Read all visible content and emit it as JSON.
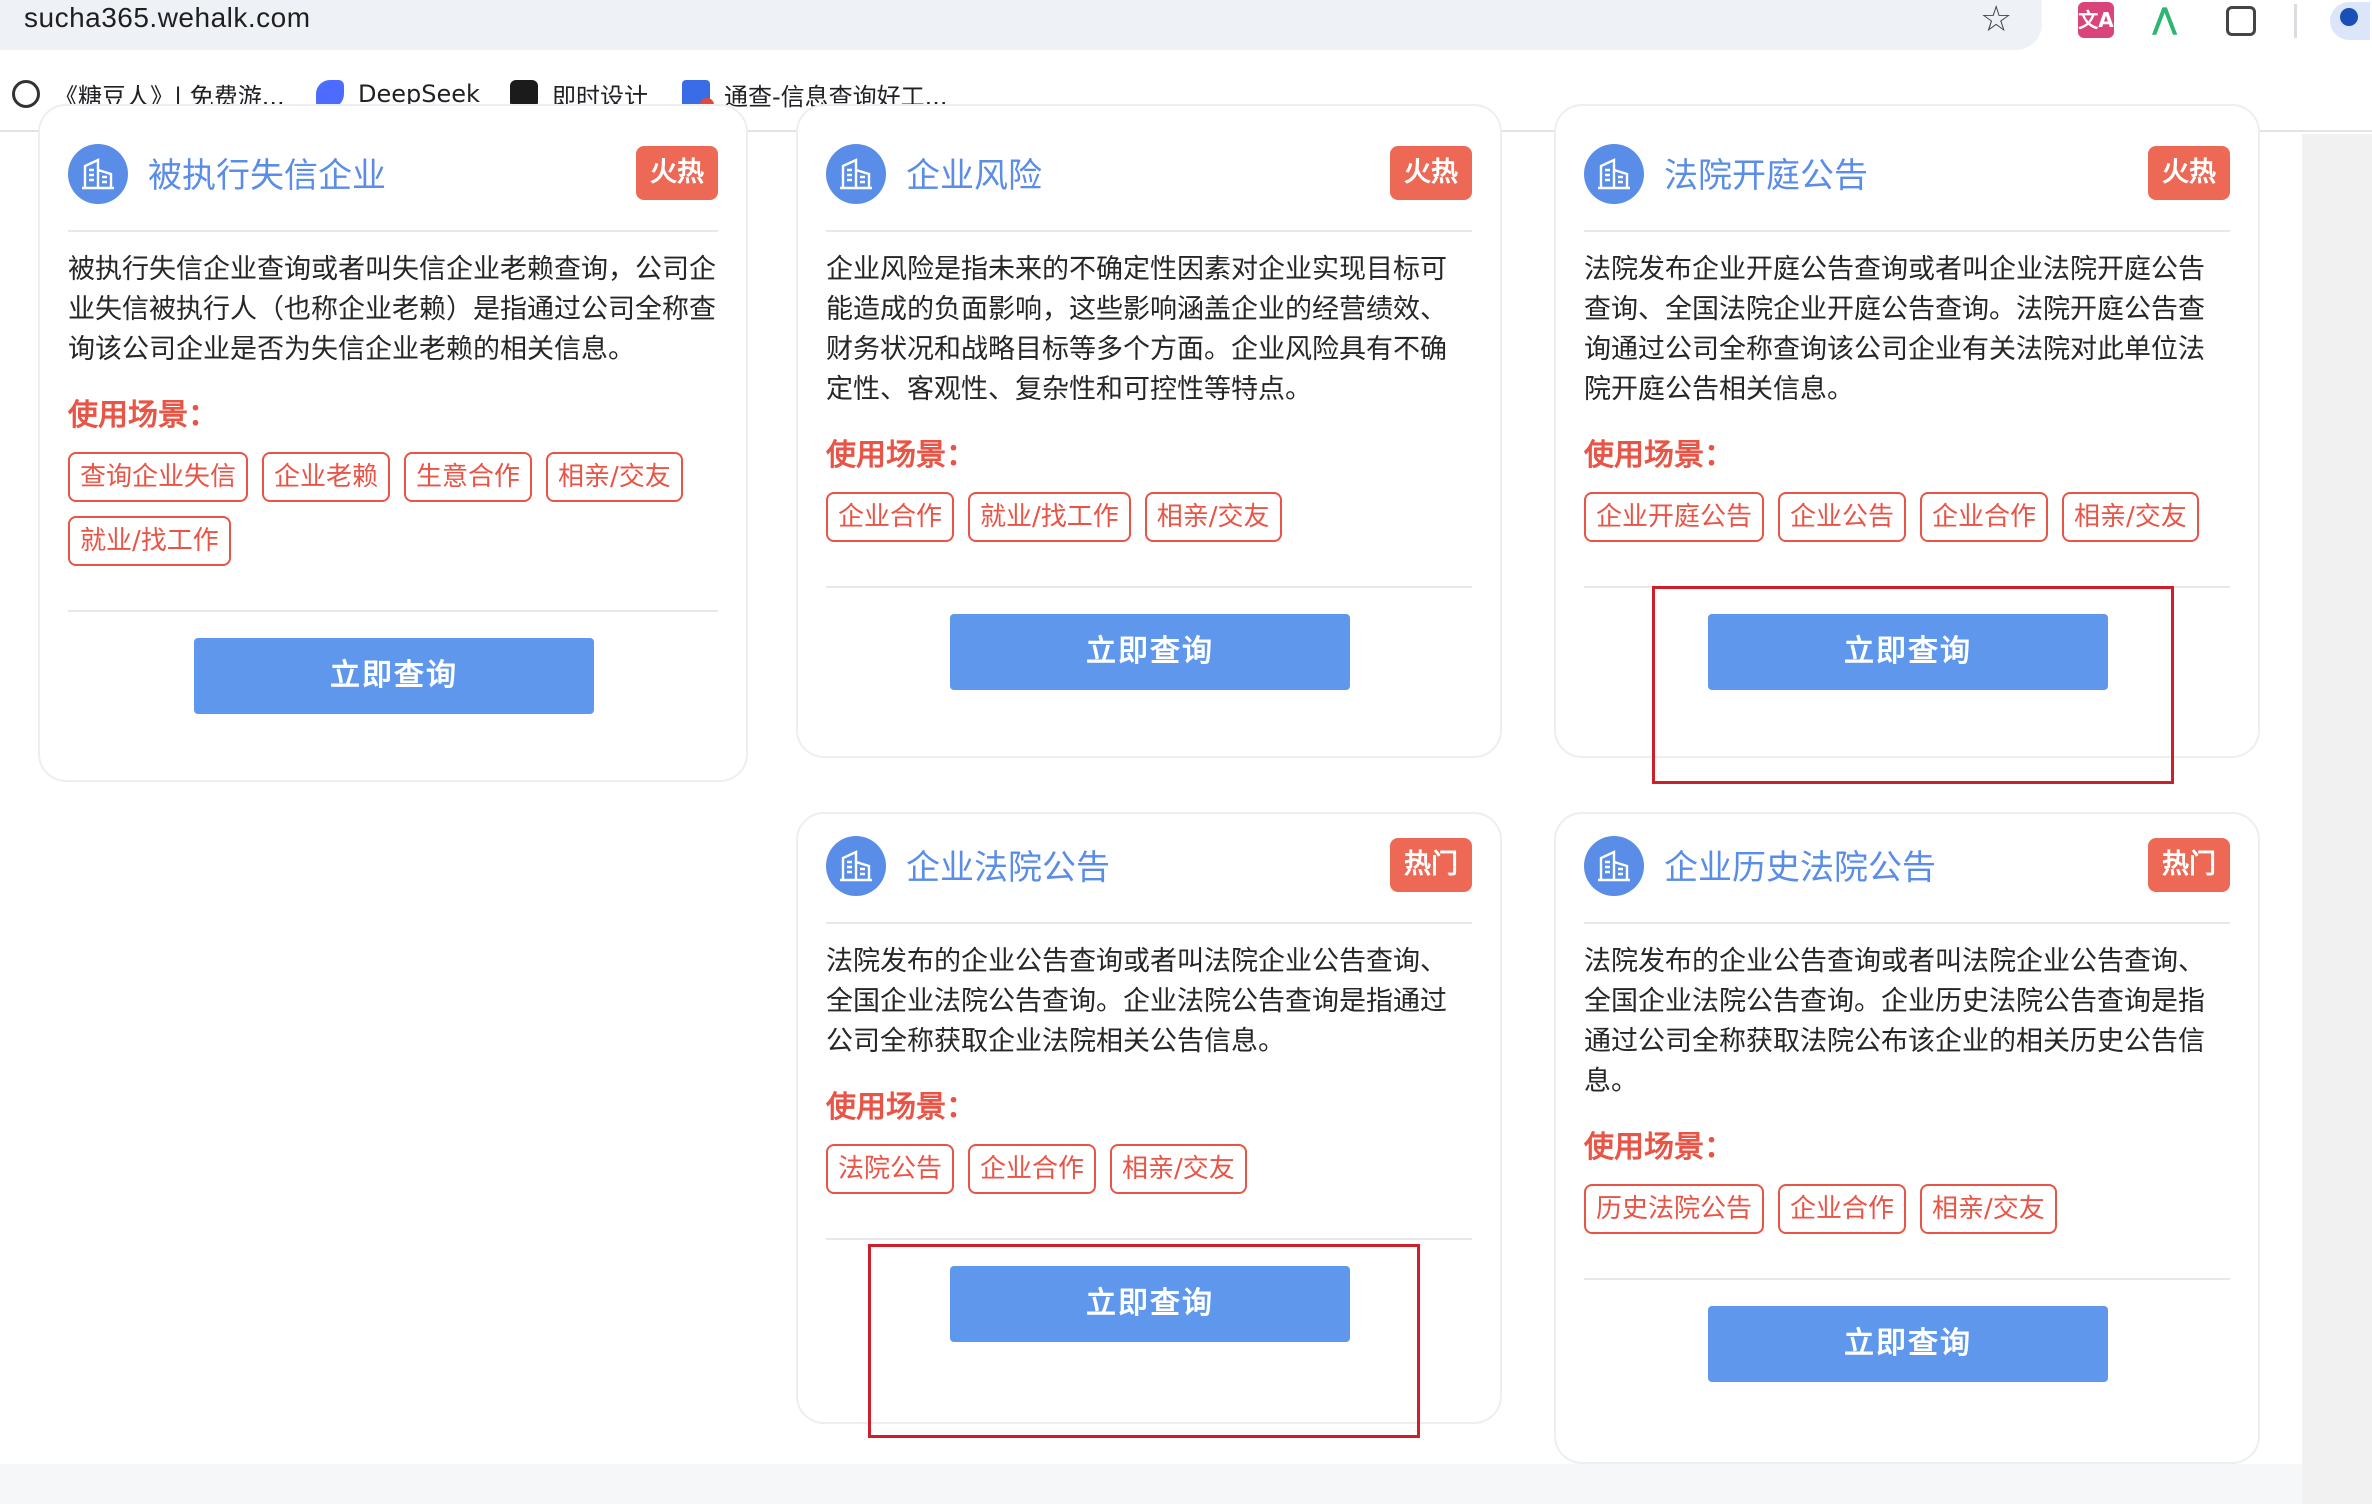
{
  "browser": {
    "url": "sucha365.wehalk.com",
    "bookmarks": [
      {
        "label": "《糖豆人》| 免费游...",
        "icon": "face-icon"
      },
      {
        "label": "DeepSeek",
        "icon": "deepseek-whale-icon"
      },
      {
        "label": "即时设计",
        "icon": "jishi-design-icon"
      },
      {
        "label": "通查-信息查询好工...",
        "icon": "tongcha-doc-icon"
      }
    ],
    "extensions": {
      "translate_label": "文A"
    }
  },
  "colors": {
    "accent_blue": "#5f97ec",
    "title_blue": "#5a8de8",
    "badge_red": "#ed6855",
    "tag_red": "#e85445",
    "highlight_red": "#cf1f2a"
  },
  "cards": [
    {
      "title": "被执行失信企业",
      "badge": "火热",
      "description": "被执行失信企业查询或者叫失信企业老赖查询，公司企业失信被执行人（也称企业老赖）是指通过公司全称查询该公司企业是否为失信企业老赖的相关信息。",
      "scene_label": "使用场景：",
      "tags": [
        "查询企业失信",
        "企业老赖",
        "生意合作",
        "相亲/交友",
        "就业/找工作"
      ],
      "button": "立即查询"
    },
    {
      "title": "企业风险",
      "badge": "火热",
      "description": "企业风险是指未来的不确定性因素对企业实现目标可能造成的负面影响，这些影响涵盖企业的经营绩效、财务状况和战略目标等多个方面。企业风险具有不确定性、客观性、复杂性和可控性等特点。",
      "scene_label": "使用场景：",
      "tags": [
        "企业合作",
        "就业/找工作",
        "相亲/交友"
      ],
      "button": "立即查询"
    },
    {
      "title": "法院开庭公告",
      "badge": "火热",
      "description": "法院发布企业开庭公告查询或者叫企业法院开庭公告查询、全国法院企业开庭公告查询。法院开庭公告查询通过公司全称查询该公司企业有关法院对此单位法院开庭公告相关信息。",
      "scene_label": "使用场景：",
      "tags": [
        "企业开庭公告",
        "企业公告",
        "企业合作",
        "相亲/交友"
      ],
      "button": "立即查询"
    },
    {
      "title": "企业法院公告",
      "badge": "热门",
      "description": "法院发布的企业公告查询或者叫法院企业公告查询、全国企业法院公告查询。企业法院公告查询是指通过公司全称获取企业法院相关公告信息。",
      "scene_label": "使用场景：",
      "tags": [
        "法院公告",
        "企业合作",
        "相亲/交友"
      ],
      "button": "立即查询"
    },
    {
      "title": "企业历史法院公告",
      "badge": "热门",
      "description": "法院发布的企业公告查询或者叫法院企业公告查询、全国企业法院公告查询。企业历史法院公告查询是指通过公司全称获取法院公布该企业的相关历史公告信息。",
      "scene_label": "使用场景：",
      "tags": [
        "历史法院公告",
        "企业合作",
        "相亲/交友"
      ],
      "button": "立即查询"
    }
  ]
}
